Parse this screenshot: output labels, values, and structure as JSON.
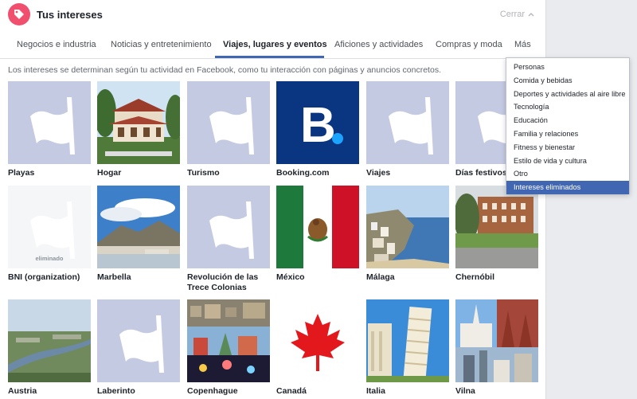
{
  "header": {
    "title": "Tus intereses",
    "close_label": "Cerrar",
    "accent_color": "#f0506e"
  },
  "tabs": [
    {
      "label": "Negocios e industria"
    },
    {
      "label": "Noticias y entretenimiento"
    },
    {
      "label": "Viajes, lugares y eventos",
      "active": true
    },
    {
      "label": "Aficiones y actividades"
    },
    {
      "label": "Compras y moda"
    },
    {
      "label": "Más"
    }
  ],
  "description": "Los intereses se determinan según tu actividad en Facebook, como tu interacción con páginas y anuncios concretos.",
  "dropdown": {
    "items": [
      "Personas",
      "Comida y bebidas",
      "Deportes y actividades al aire libre",
      "Tecnología",
      "Educación",
      "Familia y relaciones",
      "Fitness y bienestar",
      "Estilo de vida y cultura",
      "Otro",
      "Intereses eliminados"
    ],
    "selected_index": 9
  },
  "interests": [
    {
      "label": "Playas",
      "image": "flag-icon"
    },
    {
      "label": "Hogar",
      "image": "house-photo"
    },
    {
      "label": "Turismo",
      "image": "flag-icon"
    },
    {
      "label": "Booking.com",
      "image": "booking-logo",
      "logo_text": "B."
    },
    {
      "label": "Viajes",
      "image": "flag-icon"
    },
    {
      "label": "Días festivos",
      "image": "flag-icon"
    },
    {
      "label": "BNI (organization)",
      "image": "flag-icon",
      "tag": "eliminado"
    },
    {
      "label": "Marbella",
      "image": "marbella-photo"
    },
    {
      "label": "Revolución de las Trece Colonias",
      "image": "flag-icon"
    },
    {
      "label": "México",
      "image": "mexico-flag"
    },
    {
      "label": "Málaga",
      "image": "malaga-photo"
    },
    {
      "label": "Chernóbil",
      "image": "chernobil-photo"
    },
    {
      "label": "Austria",
      "image": "austria-photo"
    },
    {
      "label": "Laberinto",
      "image": "flag-icon"
    },
    {
      "label": "Copenhague",
      "image": "copenhague-photo"
    },
    {
      "label": "Canadá",
      "image": "canada-flag"
    },
    {
      "label": "Italia",
      "image": "pisa-photo"
    },
    {
      "label": "Vilna",
      "image": "vilna-photo"
    }
  ]
}
